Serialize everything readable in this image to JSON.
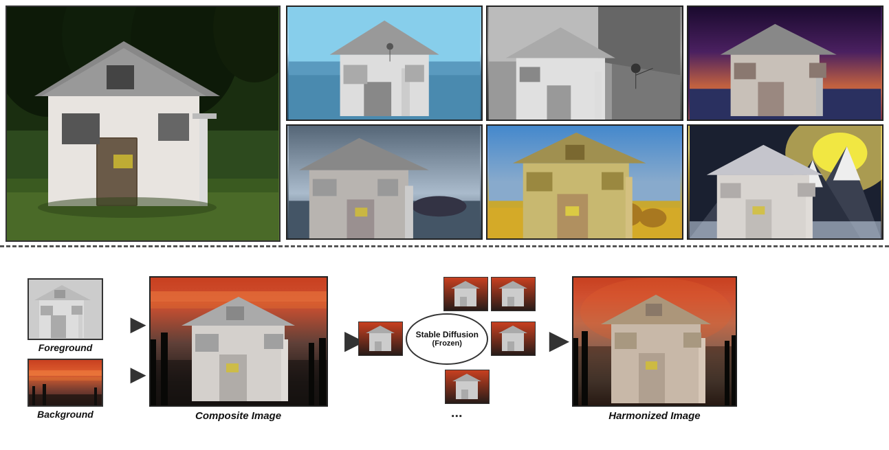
{
  "labels": {
    "foreground": "Foreground",
    "background": "Background",
    "composite_image": "Composite Image",
    "stable_diffusion": "Stable Diffusion",
    "frozen": "(Frozen)",
    "harmonized_image": "Harmonized Image",
    "dots": "..."
  },
  "colors": {
    "border_dark": "#222",
    "text_dark": "#111",
    "dashed_line": "#555",
    "bg_white": "#ffffff"
  }
}
